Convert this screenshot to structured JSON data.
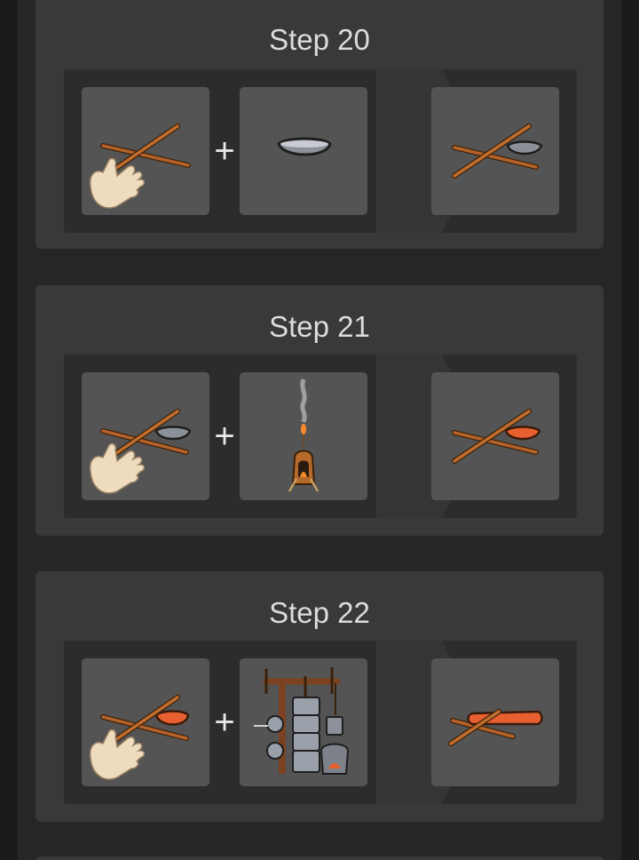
{
  "steps": [
    {
      "title": "Step 20",
      "held_icon": "crossed-sticks-icon",
      "target_icon": "stone-bowl-icon",
      "result_icon": "crossed-sticks-with-bowl-icon",
      "operator": "+"
    },
    {
      "title": "Step 21",
      "held_icon": "crossed-sticks-with-bowl-icon",
      "target_icon": "forge-lamp-icon",
      "result_icon": "crossed-sticks-with-hot-metal-icon",
      "operator": "+"
    },
    {
      "title": "Step 22",
      "held_icon": "crossed-sticks-with-hot-metal-icon",
      "target_icon": "power-hammer-icon",
      "result_icon": "crossed-sticks-with-hot-bar-icon",
      "operator": "+"
    }
  ],
  "colors": {
    "page_background": "#1b1b1b",
    "card_background": "#393939",
    "row_background": "#2c2c2c",
    "slot_background": "#545454",
    "hot_metal": "#e8602f"
  }
}
